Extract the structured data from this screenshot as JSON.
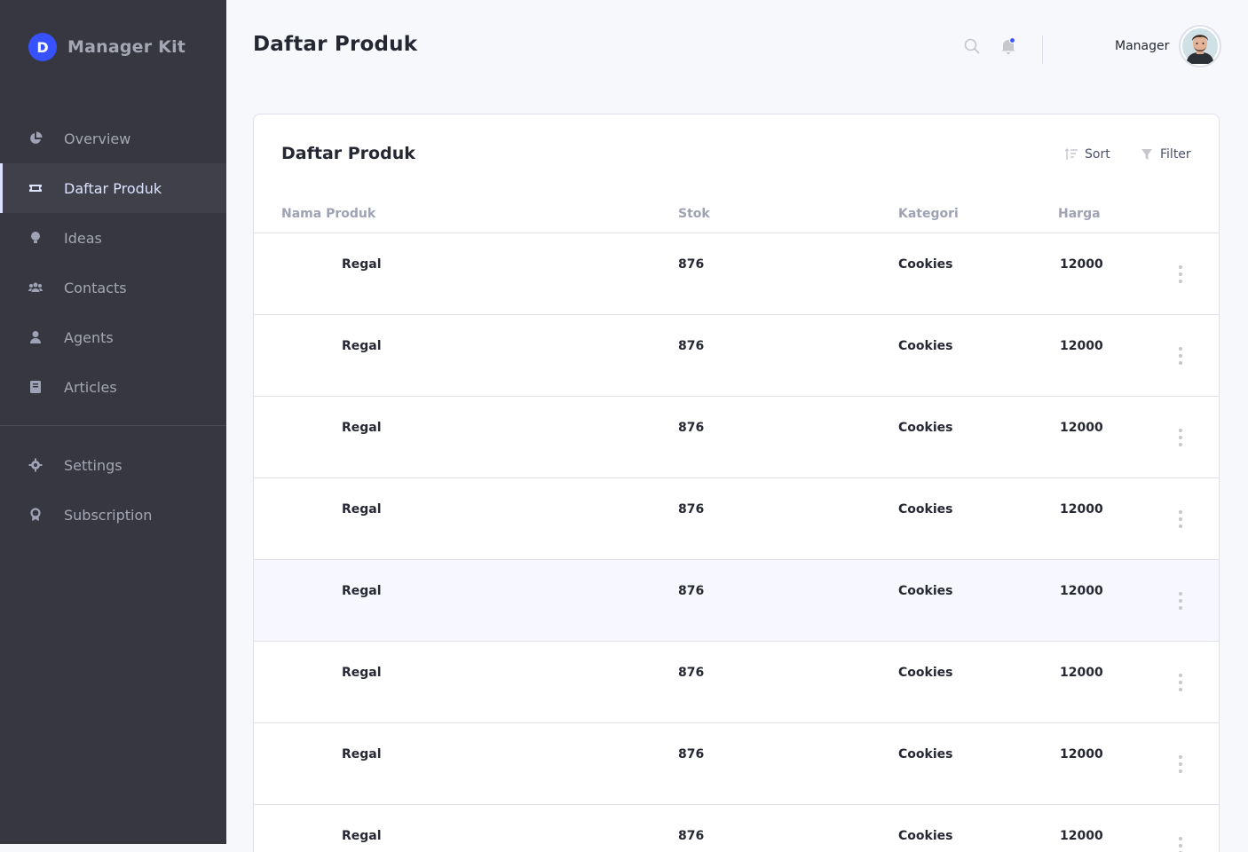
{
  "brand": {
    "name": "Manager Kit",
    "logo_letter": "D"
  },
  "header": {
    "title": "Daftar Produk",
    "user_name": "Manager"
  },
  "sidebar": {
    "main_items": [
      {
        "label": "Overview",
        "icon": "pie-chart-icon"
      },
      {
        "label": "Daftar Produk",
        "icon": "ticket-icon",
        "active": true
      },
      {
        "label": "Ideas",
        "icon": "lightbulb-icon"
      },
      {
        "label": "Contacts",
        "icon": "users-icon"
      },
      {
        "label": "Agents",
        "icon": "agent-icon"
      },
      {
        "label": "Articles",
        "icon": "book-icon"
      }
    ],
    "secondary_items": [
      {
        "label": "Settings",
        "icon": "gear-icon"
      },
      {
        "label": "Subscription",
        "icon": "award-icon"
      }
    ]
  },
  "card": {
    "title": "Daftar Produk",
    "sort_label": "Sort",
    "filter_label": "Filter",
    "columns": [
      "Nama Produk",
      "Stok",
      "Kategori",
      "Harga"
    ],
    "rows": [
      {
        "name": "Regal",
        "stok": "876",
        "kategori": "Cookies",
        "harga": "12000"
      },
      {
        "name": "Regal",
        "stok": "876",
        "kategori": "Cookies",
        "harga": "12000"
      },
      {
        "name": "Regal",
        "stok": "876",
        "kategori": "Cookies",
        "harga": "12000"
      },
      {
        "name": "Regal",
        "stok": "876",
        "kategori": "Cookies",
        "harga": "12000"
      },
      {
        "name": "Regal",
        "stok": "876",
        "kategori": "Cookies",
        "harga": "12000"
      },
      {
        "name": "Regal",
        "stok": "876",
        "kategori": "Cookies",
        "harga": "12000"
      },
      {
        "name": "Regal",
        "stok": "876",
        "kategori": "Cookies",
        "harga": "12000"
      },
      {
        "name": "Regal",
        "stok": "876",
        "kategori": "Cookies",
        "harga": "12000"
      }
    ]
  },
  "colors": {
    "sidebar_bg": "#363740",
    "accent": "#3751ff",
    "notification_dot": "#3751ff",
    "row_highlight": "#f7f8ff"
  }
}
